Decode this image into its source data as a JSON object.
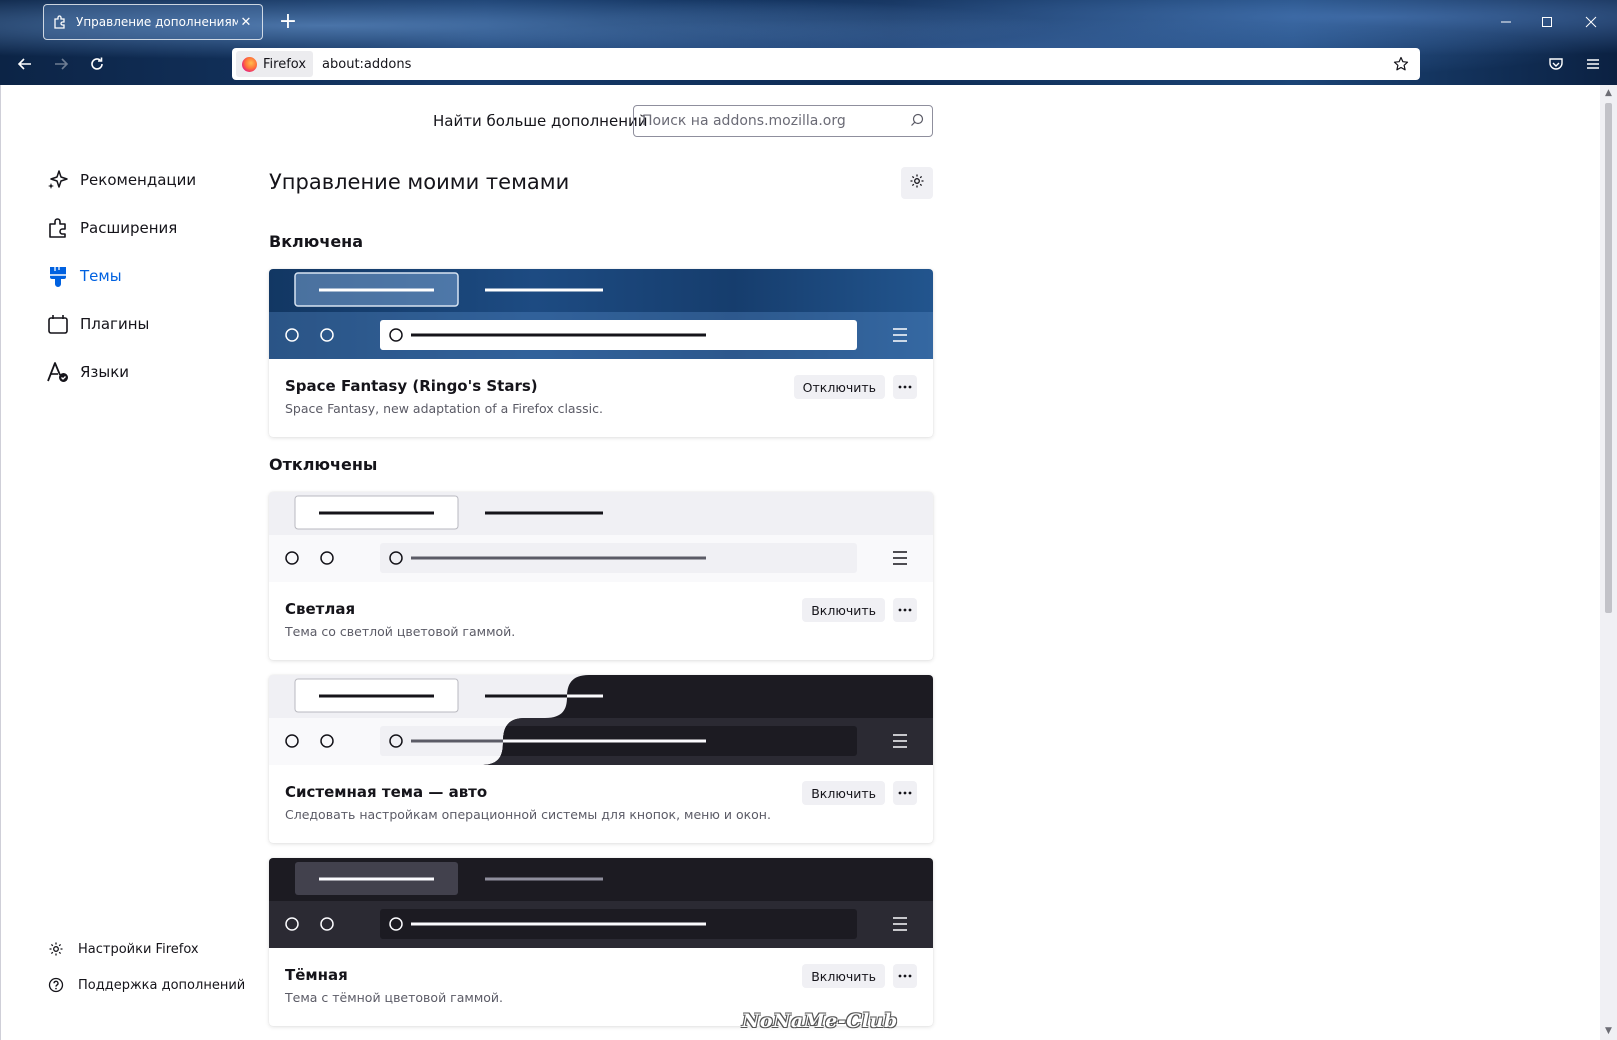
{
  "browser": {
    "tab_title": "Управление дополнениями",
    "identity_label": "Firefox",
    "url": "about:addons"
  },
  "header": {
    "find_more_label": "Найти больше дополнений",
    "search_placeholder": "Поиск на addons.mozilla.org"
  },
  "sidebar": {
    "items": [
      {
        "label": "Рекомендации",
        "icon": "sparkle-icon",
        "active": false
      },
      {
        "label": "Расширения",
        "icon": "puzzle-icon",
        "active": false
      },
      {
        "label": "Темы",
        "icon": "brush-icon",
        "active": true
      },
      {
        "label": "Плагины",
        "icon": "plugin-icon",
        "active": false
      },
      {
        "label": "Языки",
        "icon": "language-icon",
        "active": false
      }
    ],
    "bottom": [
      {
        "label": "Настройки Firefox",
        "icon": "gear-icon"
      },
      {
        "label": "Поддержка дополнений",
        "icon": "help-icon"
      }
    ]
  },
  "main": {
    "title": "Управление моими темами",
    "enabled_section": "Включена",
    "disabled_section": "Отключены",
    "themes": [
      {
        "name": "Space Fantasy (Ringo's Stars)",
        "description": "Space Fantasy, new adaptation of a Firefox classic.",
        "action": "Отключить"
      },
      {
        "name": "Светлая",
        "description": "Тема со светлой цветовой гаммой.",
        "action": "Включить"
      },
      {
        "name": "Системная тема — авто",
        "description": "Следовать настройкам операционной системы для кнопок, меню и окон.",
        "action": "Включить"
      },
      {
        "name": "Тёмная",
        "description": "Тема с тёмной цветовой гаммой.",
        "action": "Включить"
      }
    ]
  },
  "watermark": "NoNaMe-Club",
  "colors": {
    "accent": "#0061e0",
    "text": "#15141a",
    "button_bg": "#f0f0f4",
    "dark_theme": "#1c1b22"
  }
}
